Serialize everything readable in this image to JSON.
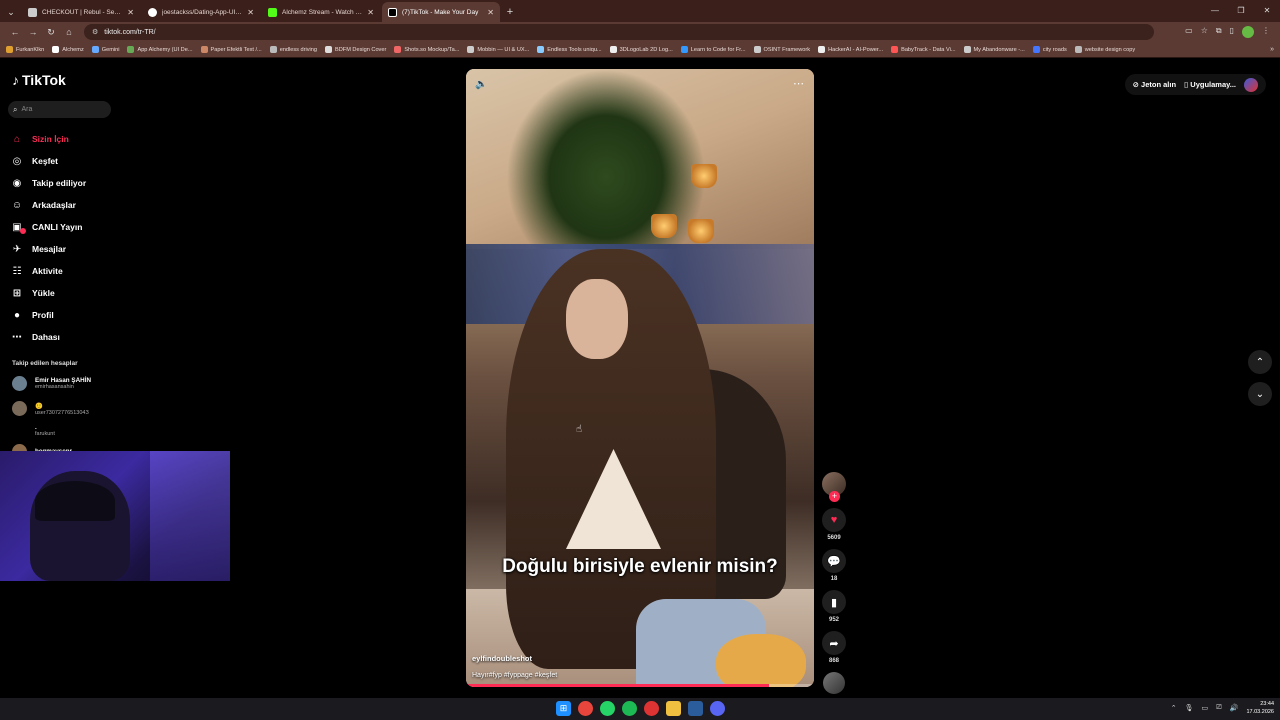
{
  "browser": {
    "tabs": [
      {
        "title": "CHECKOUT | Rebul - Sevdiğiniz",
        "color": "#cccccc"
      },
      {
        "title": "joestackss/Dating-App-UI-React",
        "color": "#ffffff"
      },
      {
        "title": "Alchemz Stream - Watch Live o",
        "color": "#53fc18"
      },
      {
        "title": "(7)TikTok - Make Your Day",
        "color": "#ffffff"
      }
    ],
    "url": "tiktok.com/tr-TR/",
    "bookmarks": [
      "FurkanKlkn",
      "Alchemz",
      "Gemini",
      "App Alchemy (UI De...",
      "Paper Efektli Text /...",
      "endless driving",
      "BDFM Design Cover",
      "Shots.so Mockup/Ta...",
      "Mobbin — UI & UX...",
      "Endless Tools uniqu...",
      "3DLogoLab 2D Log...",
      "Learn to Code for Fr...",
      "OSINT Framework",
      "HackerAI - AI-Power...",
      "BabyTrack - Data Vi...",
      "My Abandonware -...",
      "city roads",
      "website design copy"
    ]
  },
  "tiktok": {
    "logo": "TikTok",
    "search_placeholder": "Ara",
    "nav": [
      {
        "label": "Sizin İçin",
        "icon": "home-icon",
        "glyph": "⌂",
        "active": true
      },
      {
        "label": "Keşfet",
        "icon": "compass-icon",
        "glyph": "◎"
      },
      {
        "label": "Takip ediliyor",
        "icon": "following-icon",
        "glyph": "◉"
      },
      {
        "label": "Arkadaşlar",
        "icon": "friends-icon",
        "glyph": "☺"
      },
      {
        "label": "CANLI Yayın",
        "icon": "live-icon",
        "glyph": "▣"
      },
      {
        "label": "Mesajlar",
        "icon": "message-icon",
        "glyph": "✈",
        "badge": true
      },
      {
        "label": "Aktivite",
        "icon": "activity-icon",
        "glyph": "☷"
      },
      {
        "label": "Yükle",
        "icon": "upload-icon",
        "glyph": "⊞"
      },
      {
        "label": "Profil",
        "icon": "profile-icon",
        "glyph": "●"
      },
      {
        "label": "Dahası",
        "icon": "more-icon",
        "glyph": "⋯"
      }
    ],
    "following_title": "Takip edilen hesaplar",
    "accounts": [
      {
        "name": "Emir Hasan ŞAHİN",
        "user": "emirhasansahin"
      },
      {
        "name": "🙂",
        "user": "user7307277651304З"
      },
      {
        "name": ".",
        "user": "farukunt"
      },
      {
        "name": "begmavsenr",
        "user": ""
      }
    ],
    "top_right": {
      "coins": "Jeton alın",
      "app": "Uygulamay..."
    },
    "video": {
      "caption": "Doğulu birisiyle evlenir misin?",
      "username": "eylfindoubleshot",
      "description": "Hayır#fyp #fyppage #keşfet",
      "progress": 0.87
    },
    "actions": {
      "likes": "5609",
      "comments": "18",
      "saves": "952",
      "shares": "868"
    }
  },
  "taskbar": {
    "time": "23:44",
    "date": "17.03.2026"
  }
}
